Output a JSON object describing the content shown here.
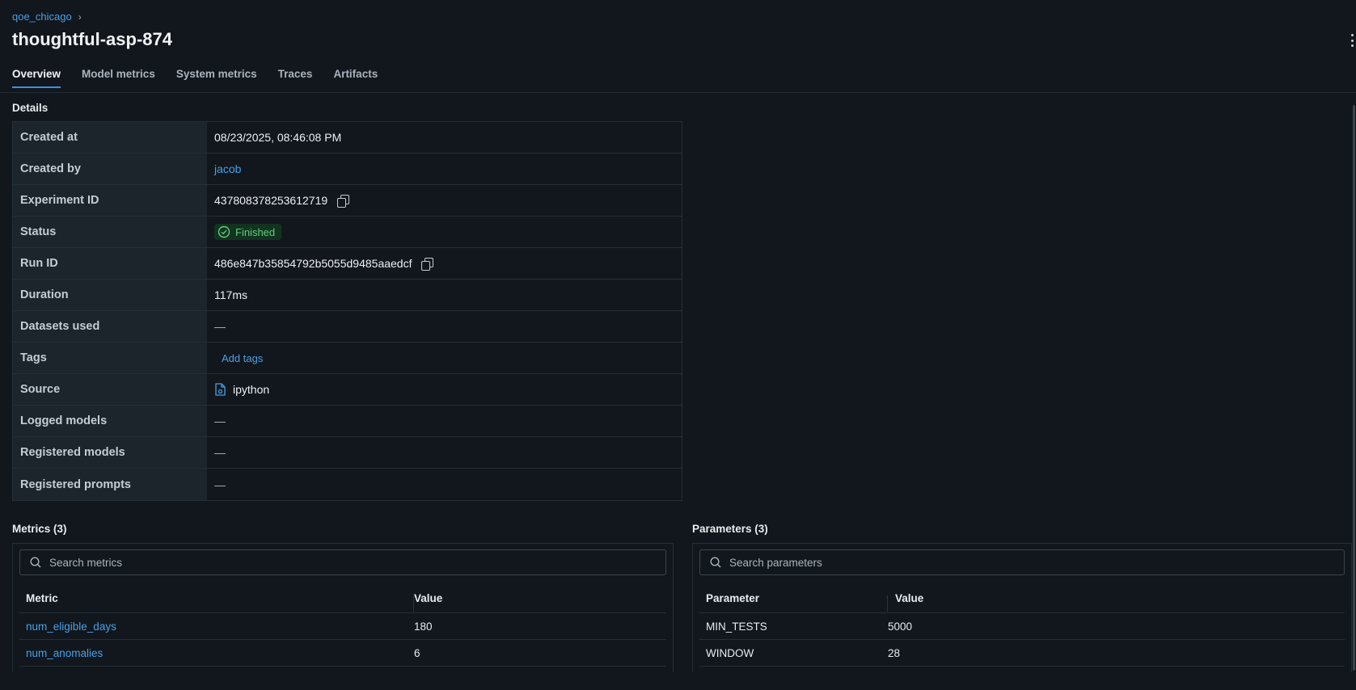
{
  "breadcrumb": {
    "parent": "qoe_chicago",
    "separator": "›"
  },
  "title": "thoughtful-asp-874",
  "tabs": [
    "Overview",
    "Model metrics",
    "System metrics",
    "Traces",
    "Artifacts"
  ],
  "active_tab": "Overview",
  "details": {
    "heading": "Details",
    "created_at_label": "Created at",
    "created_at": "08/23/2025, 08:46:08 PM",
    "created_by_label": "Created by",
    "created_by": "jacob",
    "experiment_id_label": "Experiment ID",
    "experiment_id": "437808378253612719",
    "status_label": "Status",
    "status": "Finished",
    "run_id_label": "Run ID",
    "run_id": "486e847b35854792b5055d9485aaedcf",
    "duration_label": "Duration",
    "duration": "117ms",
    "datasets_label": "Datasets used",
    "datasets": "—",
    "tags_label": "Tags",
    "add_tags": "Add tags",
    "source_label": "Source",
    "source": "ipython",
    "logged_models_label": "Logged models",
    "logged_models": "—",
    "registered_models_label": "Registered models",
    "registered_models": "—",
    "registered_prompts_label": "Registered prompts",
    "registered_prompts": "—"
  },
  "metrics": {
    "heading": "Metrics (3)",
    "search_placeholder": "Search metrics",
    "col_name": "Metric",
    "col_value": "Value",
    "rows": [
      {
        "name": "num_eligible_days",
        "value": "180"
      },
      {
        "name": "num_anomalies",
        "value": "6"
      }
    ]
  },
  "parameters": {
    "heading": "Parameters (3)",
    "search_placeholder": "Search parameters",
    "col_name": "Parameter",
    "col_value": "Value",
    "rows": [
      {
        "name": "MIN_TESTS",
        "value": "5000"
      },
      {
        "name": "WINDOW",
        "value": "28"
      }
    ]
  },
  "colors": {
    "accent": "#4a9fe8",
    "background": "#11171c",
    "success": "#5fce7e"
  }
}
